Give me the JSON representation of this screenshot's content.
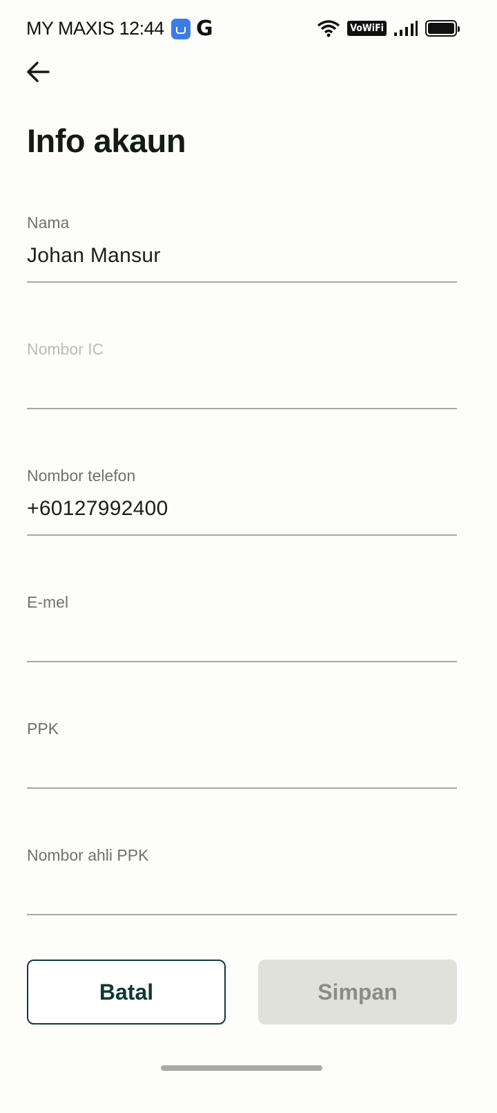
{
  "status_bar": {
    "carrier": "MY MAXIS",
    "time": "12:44",
    "vowifi": "VoWiFi"
  },
  "header": {
    "title": "Info akaun"
  },
  "fields": {
    "name": {
      "label": "Nama",
      "value": "Johan Mansur"
    },
    "ic": {
      "label": "Nombor IC",
      "value": ""
    },
    "phone": {
      "label": "Nombor telefon",
      "value": "+60127992400"
    },
    "email": {
      "label": "E-mel",
      "value": ""
    },
    "ppk": {
      "label": "PPK",
      "value": ""
    },
    "ppk_member": {
      "label": "Nombor ahli PPK",
      "value": ""
    }
  },
  "buttons": {
    "cancel": "Batal",
    "save": "Simpan"
  }
}
